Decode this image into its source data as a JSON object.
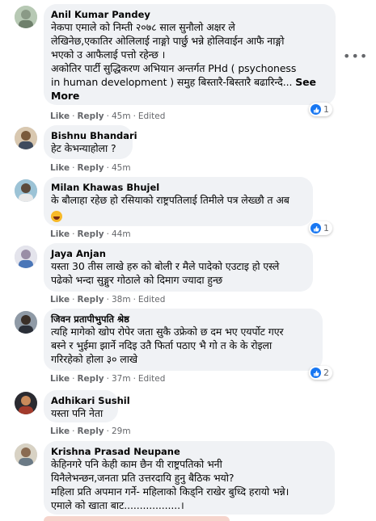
{
  "comments": [
    {
      "name": "Anil Kumar Pandey",
      "lines": [
        "नेकपा एमाले को निम्ती २०७८ साल सुनौलो अक्षर ले",
        "लेखिनेछ,एकातिर ओलिलाई नाङ्गो पार्छु भन्ने होलिवाईन आफै नाङ्गो",
        "भएको उ आफैलाई पत्तो रहेन्छ ।",
        "अकोतिर पार्टी सुद्धिकरण अभियान अन्तर्गत PHd ( psychoness",
        "in human development ) समुह बिस्तारै-बिस्तारै बढारिन्दै..."
      ],
      "more_a": "See",
      "more_b": "More",
      "like": "Like",
      "reply": "Reply",
      "time": "45m",
      "edited": "Edited",
      "reactions": "1"
    },
    {
      "name": "Bishnu Bhandari",
      "lines": [
        "हेट केभन्याहोला ?"
      ],
      "like": "Like",
      "reply": "Reply",
      "time": "45m"
    },
    {
      "name": "Milan Khawas Bhujel",
      "lines": [
        "के बौलाहा रहेछ हो रसियाको राष्ट्रपतिलाई तिमीले पत्र लेख्छौ त अब"
      ],
      "like": "Like",
      "reply": "Reply",
      "time": "44m",
      "reactions": "1"
    },
    {
      "name": "Jaya Anjan",
      "lines": [
        "यस्ता 30 तीस लाखे हरु को बोली र मैले पादेको एउटाइ हो एस्ले",
        "पढेको भन्दा सुङ्गुर गोठाले को दिमाग ज्यादा हुन्छ"
      ],
      "like": "Like",
      "reply": "Reply",
      "time": "38m",
      "edited": "Edited"
    },
    {
      "name": "जिवन प्रतापीभुपति श्रेष्ठ",
      "lines": [
        "त्यहि मागेको खोप रोपेर जता सुकै उफ्रेको छ दम भए एयर्पोट गएर",
        "बस्ने र भुईमा झार्ने नदिइ उतै फिर्ता पठाए भै गो त के के रोइला",
        "गरिरहेको होला ३० लाखे"
      ],
      "like": "Like",
      "reply": "Reply",
      "time": "37m",
      "edited": "Edited",
      "reactions": "2"
    },
    {
      "name": "Adhikari Sushil",
      "lines": [
        "यस्ता पनि नेता"
      ],
      "like": "Like",
      "reply": "Reply",
      "time": "29m"
    },
    {
      "name": "Krishna Prasad Neupane",
      "lines": [
        "केहिनगरे पनि केही काम छैन यी राष्ट्रपतिको भनी",
        "यिनैलेभन्छन,जनता प्रति उत्तरदायि हुनु बैठिक भयो?",
        "महिला प्रति अपमान गर्ने- महिलाको किड्नि राखेर बुध्दि हरायो भन्ने।",
        "एमाले को खाता बाट..................।"
      ]
    }
  ],
  "more_menu": "•••",
  "dot": "·",
  "colors": {
    "accent": "#1877f2",
    "bubble": "#f0f2f5",
    "meta": "#65676b"
  }
}
